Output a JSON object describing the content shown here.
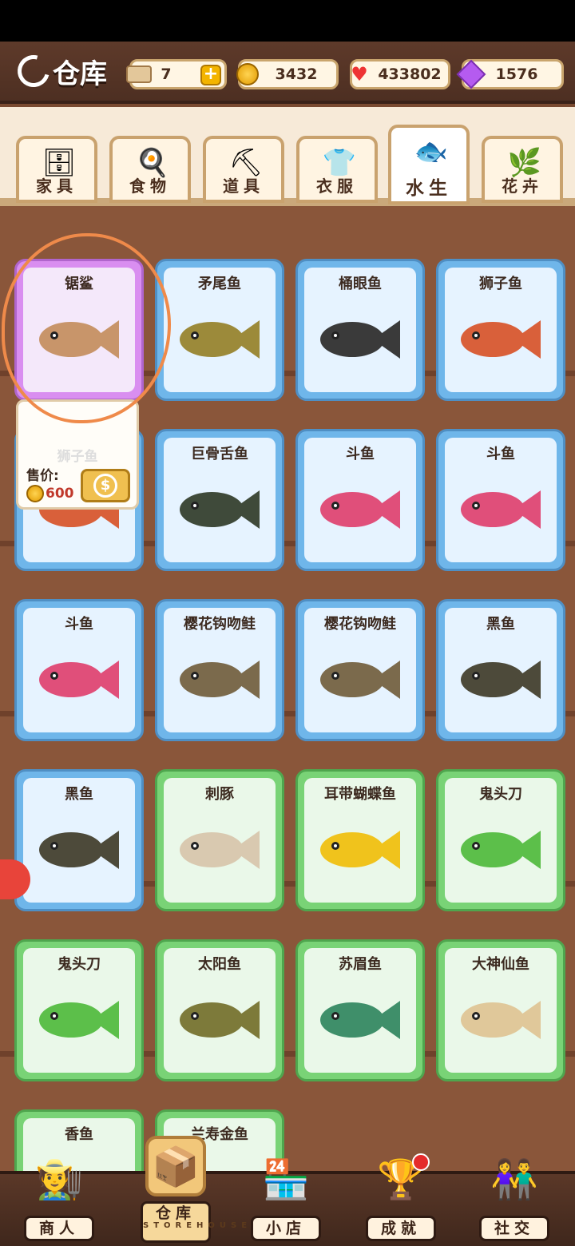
{
  "header": {
    "title": "仓库",
    "tickets": "7",
    "coins": "3432",
    "hearts": "433802",
    "gems": "1576"
  },
  "tabs": [
    {
      "label": "家具",
      "icon": "dresser-icon"
    },
    {
      "label": "食物",
      "icon": "egg-icon"
    },
    {
      "label": "道具",
      "icon": "shovel-icon"
    },
    {
      "label": "衣服",
      "icon": "shirt-icon"
    },
    {
      "label": "水生",
      "icon": "fish-icon",
      "active": true
    },
    {
      "label": "花卉",
      "icon": "plant-icon"
    }
  ],
  "items": [
    {
      "name": "锯鲨",
      "rarity": "purple",
      "color": "#c8956a"
    },
    {
      "name": "矛尾鱼",
      "rarity": "blue",
      "color": "#9c8a3a"
    },
    {
      "name": "桶眼鱼",
      "rarity": "blue",
      "color": "#3a3a3a"
    },
    {
      "name": "狮子鱼",
      "rarity": "blue",
      "color": "#d9603a"
    },
    {
      "name": "狮子鱼",
      "rarity": "blue",
      "color": "#d9603a"
    },
    {
      "name": "巨骨舌鱼",
      "rarity": "blue",
      "color": "#3f4a3a"
    },
    {
      "name": "斗鱼",
      "rarity": "blue",
      "color": "#e04f7a"
    },
    {
      "name": "斗鱼",
      "rarity": "blue",
      "color": "#e04f7a"
    },
    {
      "name": "斗鱼",
      "rarity": "blue",
      "color": "#e04f7a"
    },
    {
      "name": "樱花钩吻鲑",
      "rarity": "blue",
      "color": "#7b6a4c"
    },
    {
      "name": "樱花钩吻鲑",
      "rarity": "blue",
      "color": "#7b6a4c"
    },
    {
      "name": "黑鱼",
      "rarity": "blue",
      "color": "#4d4a3a"
    },
    {
      "name": "黑鱼",
      "rarity": "blue",
      "color": "#4d4a3a"
    },
    {
      "name": "刺豚",
      "rarity": "green",
      "color": "#d9c9b0"
    },
    {
      "name": "耳带蝴蝶鱼",
      "rarity": "green",
      "color": "#f0c31c"
    },
    {
      "name": "鬼头刀",
      "rarity": "green",
      "color": "#5cbf4a"
    },
    {
      "name": "鬼头刀",
      "rarity": "green",
      "color": "#5cbf4a"
    },
    {
      "name": "太阳鱼",
      "rarity": "green",
      "color": "#7d7a3a"
    },
    {
      "name": "苏眉鱼",
      "rarity": "green",
      "color": "#3f8f6a"
    },
    {
      "name": "大神仙鱼",
      "rarity": "green",
      "color": "#e0c89a"
    },
    {
      "name": "香鱼",
      "rarity": "green",
      "color": "#8aa86a"
    },
    {
      "name": "兰寿金鱼",
      "rarity": "green",
      "color": "#e07a3a"
    }
  ],
  "popup": {
    "ghost_name": "狮子鱼",
    "sell_label": "售价:",
    "price": "600",
    "sell_button": "$"
  },
  "nav": [
    {
      "label": "商人",
      "icon": "merchant-icon"
    },
    {
      "label": "仓库",
      "sub": "STOREHOUSE",
      "icon": "storehouse-icon",
      "active": true
    },
    {
      "label": "小店",
      "icon": "shop-icon"
    },
    {
      "label": "成就",
      "icon": "achievement-icon",
      "badge": true
    },
    {
      "label": "社交",
      "icon": "social-icon"
    }
  ],
  "colors": {
    "accent": "#f3b400",
    "annotation": "#ef8a4a",
    "blue_card": "#6fb6ea",
    "green_card": "#79d376",
    "purple_card": "#d98ef0"
  }
}
